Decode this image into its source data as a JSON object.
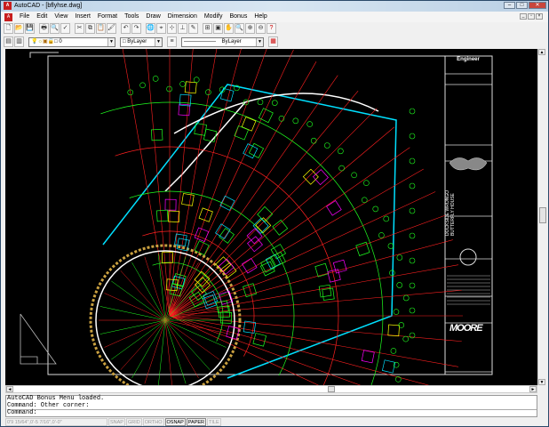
{
  "window": {
    "title": "AutoCAD - [bflyhse.dwg]",
    "icon": "autocad-icon",
    "controls": [
      "minimize",
      "maximize",
      "close"
    ]
  },
  "menu": [
    "File",
    "Edit",
    "View",
    "Insert",
    "Format",
    "Tools",
    "Draw",
    "Dimension",
    "Modify",
    "Bonus",
    "Help"
  ],
  "toolbar_standard": [
    "new",
    "open",
    "save",
    "print",
    "preview",
    "spell",
    "cut",
    "copy",
    "paste",
    "match-properties",
    "undo",
    "redo",
    "launch-browser",
    "osnap",
    "tracking",
    "ucs",
    "properties",
    "named-views",
    "redraw",
    "pan",
    "zoom-realtime",
    "zoom-window",
    "zoom-previous",
    "help"
  ],
  "toolbar_object": {
    "layer_value": "0",
    "color_value": "ByLayer",
    "linetype_value": "ByLayer"
  },
  "title_block": {
    "heading": "Engineer",
    "project_lines": [
      "DOCKSIDE WRONGO",
      "BUTTERFLY HOUSE"
    ],
    "logo": "MOORE"
  },
  "command": {
    "lines": [
      "AutoCAD Bonus Menu loaded.",
      "Command: Other corner:"
    ],
    "prompt": "Command:"
  },
  "status": {
    "coords": "0'9 15/64\",0'-5 7/16\",0'-0\"",
    "toggles": [
      {
        "label": "SNAP",
        "on": false
      },
      {
        "label": "GRID",
        "on": false
      },
      {
        "label": "ORTHO",
        "on": false
      },
      {
        "label": "OSNAP",
        "on": true
      },
      {
        "label": "PAPER",
        "on": true
      },
      {
        "label": "TILE",
        "on": false
      }
    ]
  },
  "colors": {
    "canvas": "#000000",
    "red": "#ff2020",
    "green": "#20ff20",
    "cyan": "#00e0ff",
    "yellow": "#ffff00",
    "magenta": "#ff00ff"
  }
}
